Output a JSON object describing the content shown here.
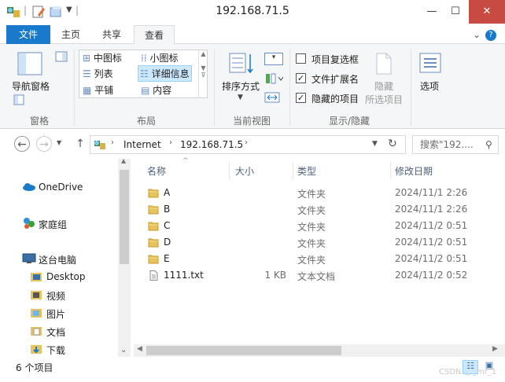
{
  "window": {
    "title": "192.168.71.5"
  },
  "tabs": {
    "file": "文件",
    "home": "主页",
    "share": "共享",
    "view": "查看"
  },
  "ribbon": {
    "nav_pane": "导航窗格",
    "pane_group": "窗格",
    "layouts": {
      "medium_icons": "中图标",
      "small_icons": "小图标",
      "list": "列表",
      "details": "详细信息",
      "tiles": "平铺",
      "content": "内容"
    },
    "layout_group": "布局",
    "sort_by": "排序方式",
    "current_view_group": "当前视图",
    "item_checkboxes": "项目复选框",
    "file_extensions": "文件扩展名",
    "hidden_items": "隐藏的项目",
    "hide_selected_1": "隐藏",
    "hide_selected_2": "所选项目",
    "show_hide_group": "显示/隐藏",
    "options": "选项",
    "checks": {
      "item_checkboxes": false,
      "file_extensions": true,
      "hidden_items": true
    }
  },
  "address": {
    "segments": [
      "Internet",
      "192.168.71.5"
    ],
    "search_placeholder": "搜索\"192...."
  },
  "nav": {
    "onedrive": "OneDrive",
    "homegroup": "家庭组",
    "this_pc": "这台电脑",
    "items": [
      "Desktop",
      "视频",
      "图片",
      "文档",
      "下载"
    ]
  },
  "columns": {
    "name": "名称",
    "size": "大小",
    "type": "类型",
    "date": "修改日期"
  },
  "files": [
    {
      "name": "A",
      "size": "",
      "type": "文件夹",
      "date": "2024/11/1 2:26",
      "kind": "folder"
    },
    {
      "name": "B",
      "size": "",
      "type": "文件夹",
      "date": "2024/11/1 2:26",
      "kind": "folder"
    },
    {
      "name": "C",
      "size": "",
      "type": "文件夹",
      "date": "2024/11/2 0:51",
      "kind": "folder"
    },
    {
      "name": "D",
      "size": "",
      "type": "文件夹",
      "date": "2024/11/2 0:51",
      "kind": "folder"
    },
    {
      "name": "E",
      "size": "",
      "type": "文件夹",
      "date": "2024/11/2 0:51",
      "kind": "folder"
    },
    {
      "name": "1111.txt",
      "size": "1 KB",
      "type": "文本文档",
      "date": "2024/11/2 0:52",
      "kind": "file"
    }
  ],
  "status": {
    "item_count": "6 个项目",
    "watermark": "CSDN @gmr_1"
  },
  "colors": {
    "accent": "#1979ca",
    "close": "#c74a43",
    "folder": "#e8c25c"
  }
}
